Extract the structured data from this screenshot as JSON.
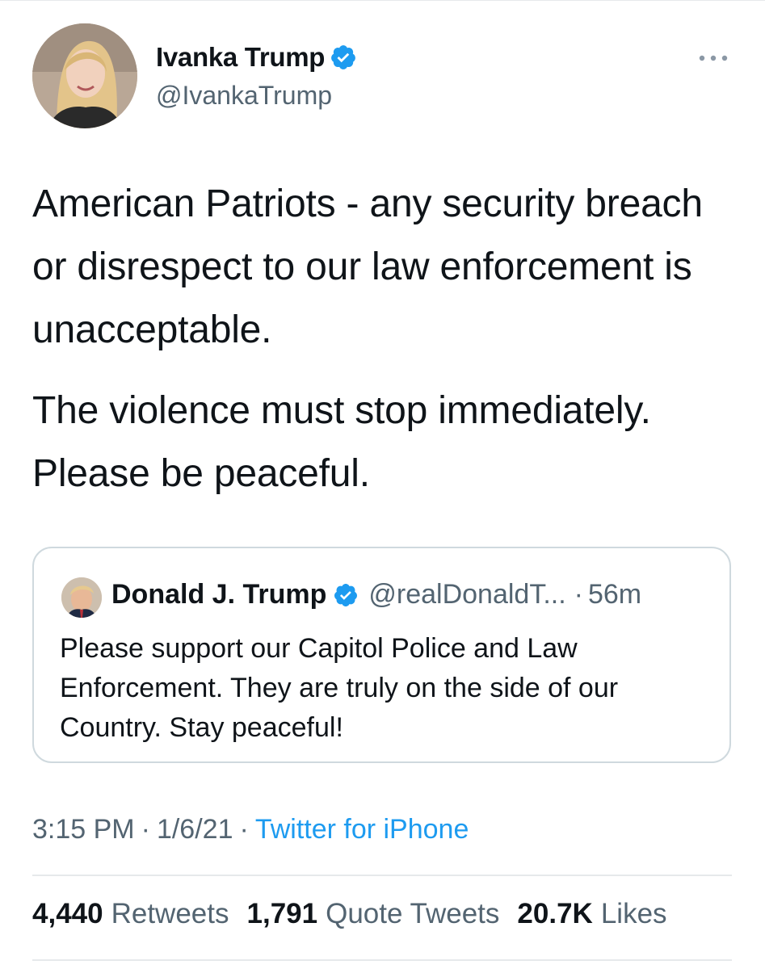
{
  "tweet": {
    "author_name": "Ivanka Trump",
    "author_handle": "@IvankaTrump",
    "verified": true,
    "paragraphs": [
      "American Patriots - any security breach or disrespect to our law enforcement is unacceptable.",
      "The violence must stop immediately. Please be peaceful."
    ]
  },
  "quoted_tweet": {
    "author_name": "Donald J. Trump",
    "author_handle": "@realDonaldT...",
    "separator": "·",
    "time": "56m",
    "text": "Please support our Capitol Police and Law Enforcement. They are truly on the side of our Country. Stay peaceful!"
  },
  "meta": {
    "time": "3:15 PM",
    "date": "1/6/21",
    "source": "Twitter for iPhone",
    "separator": "·"
  },
  "stats": {
    "retweets_count": "4,440",
    "retweets_label": "Retweets",
    "quotes_count": "1,791",
    "quotes_label": "Quote Tweets",
    "likes_count": "20.7K",
    "likes_label": "Likes"
  },
  "colors": {
    "accent": "#1d9bf0",
    "secondary_text": "#536471",
    "primary_text": "#0f1419",
    "border": "#cfd9de"
  },
  "icons": {
    "verified": "verified-badge-icon",
    "more": "more-options-icon"
  }
}
